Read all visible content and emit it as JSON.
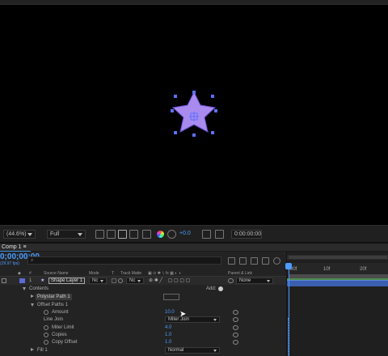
{
  "viewer": {
    "zoom": "(44.6%)",
    "resolution": "Full",
    "exposure": "+0.0",
    "timecode": "0:00:00:00"
  },
  "timeline": {
    "tab_label": "Comp 1",
    "current_time": "0;00;00;00",
    "fps": "(29.97 fps)",
    "search_placeholder": "⌕",
    "columns": {
      "num": "#",
      "source_name": "Source Name",
      "mode": "Mode",
      "t": "T",
      "track_matte": "Track Matte",
      "parent_link": "Parent & Link"
    },
    "layer": {
      "number": "1",
      "name": "Shape Layer 1",
      "mode": "Nc",
      "matte": "Nc",
      "parent": "None"
    },
    "rows": {
      "contents": "Contents",
      "add_label": "Add:",
      "polystar": "Polystar Path 1",
      "offset_paths": "Offset Paths 1",
      "amount": "Amount",
      "amount_value": "10.0",
      "line_join": "Line Join",
      "line_join_value": "Miter Join",
      "miter_limit": "Miter Limit",
      "miter_limit_value": "4.0",
      "copies": "Copies",
      "copies_value": "1.0",
      "copy_offset": "Copy Offset",
      "copy_offset_value": "1.0",
      "fill": "Fill 1",
      "fill_value": "Normal"
    },
    "ruler": [
      "00f",
      "10f",
      "20f"
    ]
  },
  "colors": {
    "accent": "#4d9cff",
    "star_fill": "#a98bf0",
    "layer_label": "#5b6ad6",
    "layer_bar": "#3a5fb0"
  }
}
